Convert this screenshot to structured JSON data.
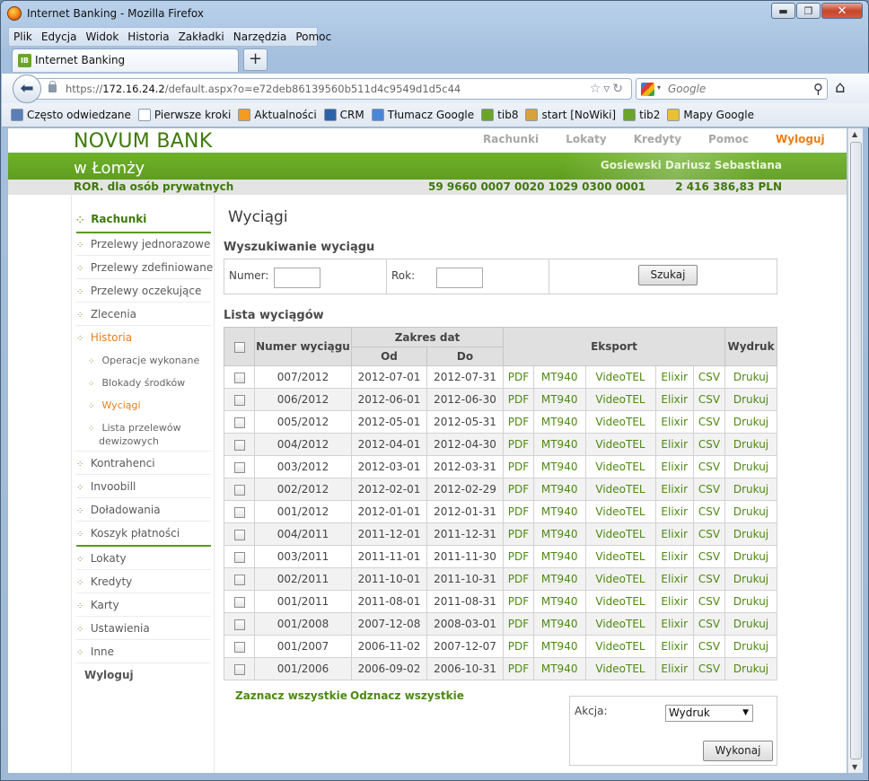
{
  "window": {
    "title": "Internet Banking - Mozilla Firefox",
    "min": "▬",
    "max": "❐",
    "close": "✕"
  },
  "menu": [
    "Plik",
    "Edycja",
    "Widok",
    "Historia",
    "Zakładki",
    "Narzędzia",
    "Pomoc"
  ],
  "tab": {
    "label": "Internet Banking",
    "icon_text": "IB",
    "new_tab": "+"
  },
  "url": {
    "prefix": "https://",
    "host": "172.16.24.2",
    "path": "/default.aspx?o=e72deb86139560b511d4c9549d1d5c44"
  },
  "search": {
    "placeholder": "Google"
  },
  "bookmarks": [
    {
      "label": "Często odwiedzane",
      "color": "#5a7fb8"
    },
    {
      "label": "Pierwsze kroki",
      "color": "#ffffff"
    },
    {
      "label": "Aktualności",
      "color": "#f39b22"
    },
    {
      "label": "CRM",
      "color": "#2b63a8"
    },
    {
      "label": "Tłumacz Google",
      "color": "#4a86d8"
    },
    {
      "label": "tib8",
      "color": "#6aa529"
    },
    {
      "label": "start [NoWiki]",
      "color": "#d6a23a"
    },
    {
      "label": "tib2",
      "color": "#6aa529"
    },
    {
      "label": "Mapy Google",
      "color": "#e8c031"
    }
  ],
  "bank": {
    "name": "NOVUM BANK",
    "branch": "w Łomży",
    "nav": [
      "Rachunki",
      "Lokaty",
      "Kredyty",
      "Pomoc",
      "Wyloguj"
    ],
    "user": "Gosiewski Dariusz Sebastiana",
    "account_type": "ROR. dla osób prywatnych",
    "account_number": "59 9660 0007 0020 1029 0300 0001",
    "balance": "2 416 386,83 PLN"
  },
  "sidebar": {
    "top": "Rachunki",
    "items": [
      "Przelewy jednorazowe",
      "Przelewy zdefiniowane",
      "Przelewy oczekujące",
      "Zlecenia",
      "Historia"
    ],
    "sub": [
      "Operacje wykonane",
      "Blokady środków",
      "Wyciągi",
      "Lista przelewów",
      "dewizowych"
    ],
    "items2": [
      "Kontrahenci",
      "Invoobill",
      "Doładowania",
      "Koszyk płatności"
    ],
    "items3": [
      "Lokaty",
      "Kredyty",
      "Karty",
      "Ustawienia",
      "Inne"
    ],
    "logout": "Wyloguj"
  },
  "main": {
    "title": "Wyciągi",
    "search_heading": "Wyszukiwanie wyciągu",
    "numer_label": "Numer:",
    "rok_label": "Rok:",
    "search_button": "Szukaj",
    "list_heading": "Lista wyciągów",
    "select_all": "Zaznacz wszystkie",
    "deselect_all": "Odznacz wszystkie",
    "akcja_label": "Akcja:",
    "akcja_value": "Wydruk",
    "execute_button": "Wykonaj"
  },
  "table": {
    "headers": {
      "numer": "Numer wyciągu",
      "zakres": "Zakres dat",
      "od": "Od",
      "do": "Do",
      "eksport": "Eksport",
      "wydruk": "Wydruk"
    },
    "export_links": [
      "PDF",
      "MT940",
      "VideoTEL",
      "Elixir",
      "CSV"
    ],
    "print_link": "Drukuj",
    "rows": [
      [
        "007/2012",
        "2012-07-01",
        "2012-07-31"
      ],
      [
        "006/2012",
        "2012-06-01",
        "2012-06-30"
      ],
      [
        "005/2012",
        "2012-05-01",
        "2012-05-31"
      ],
      [
        "004/2012",
        "2012-04-01",
        "2012-04-30"
      ],
      [
        "003/2012",
        "2012-03-01",
        "2012-03-31"
      ],
      [
        "002/2012",
        "2012-02-01",
        "2012-02-29"
      ],
      [
        "001/2012",
        "2012-01-01",
        "2012-01-31"
      ],
      [
        "004/2011",
        "2011-12-01",
        "2011-12-31"
      ],
      [
        "003/2011",
        "2011-11-01",
        "2011-11-30"
      ],
      [
        "002/2011",
        "2011-10-01",
        "2011-10-31"
      ],
      [
        "001/2011",
        "2011-08-01",
        "2011-08-31"
      ],
      [
        "001/2008",
        "2007-12-08",
        "2008-03-01"
      ],
      [
        "001/2007",
        "2006-11-02",
        "2007-12-07"
      ],
      [
        "001/2006",
        "2006-09-02",
        "2006-10-31"
      ]
    ]
  }
}
